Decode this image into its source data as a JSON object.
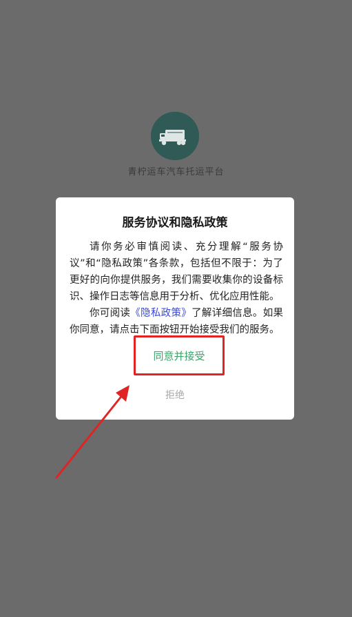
{
  "app": {
    "name": "青柠运车汽车托运平台",
    "logo_icon": "truck-icon",
    "logo_color": "#2f5a55"
  },
  "dialog": {
    "title": "服务协议和隐私政策",
    "paragraph1": "请你务必审慎阅读、充分理解“服务协议”和“隐私政策”各条款，包括但不限于：为了更好的向你提供服务，我们需要收集你的设备标识、操作日志等信息用于分析、优化应用性能。",
    "paragraph2_prefix": "你可阅读",
    "paragraph2_link": "《隐私政策》",
    "paragraph2_suffix": "了解详细信息。如果你同意，请点击下面按钮开始接受我们的服务。",
    "agree_label": "同意并接受",
    "refuse_label": "拒绝",
    "link_color": "#3a4bd6",
    "agree_color": "#3aa56a",
    "highlight_color": "#e02424"
  }
}
